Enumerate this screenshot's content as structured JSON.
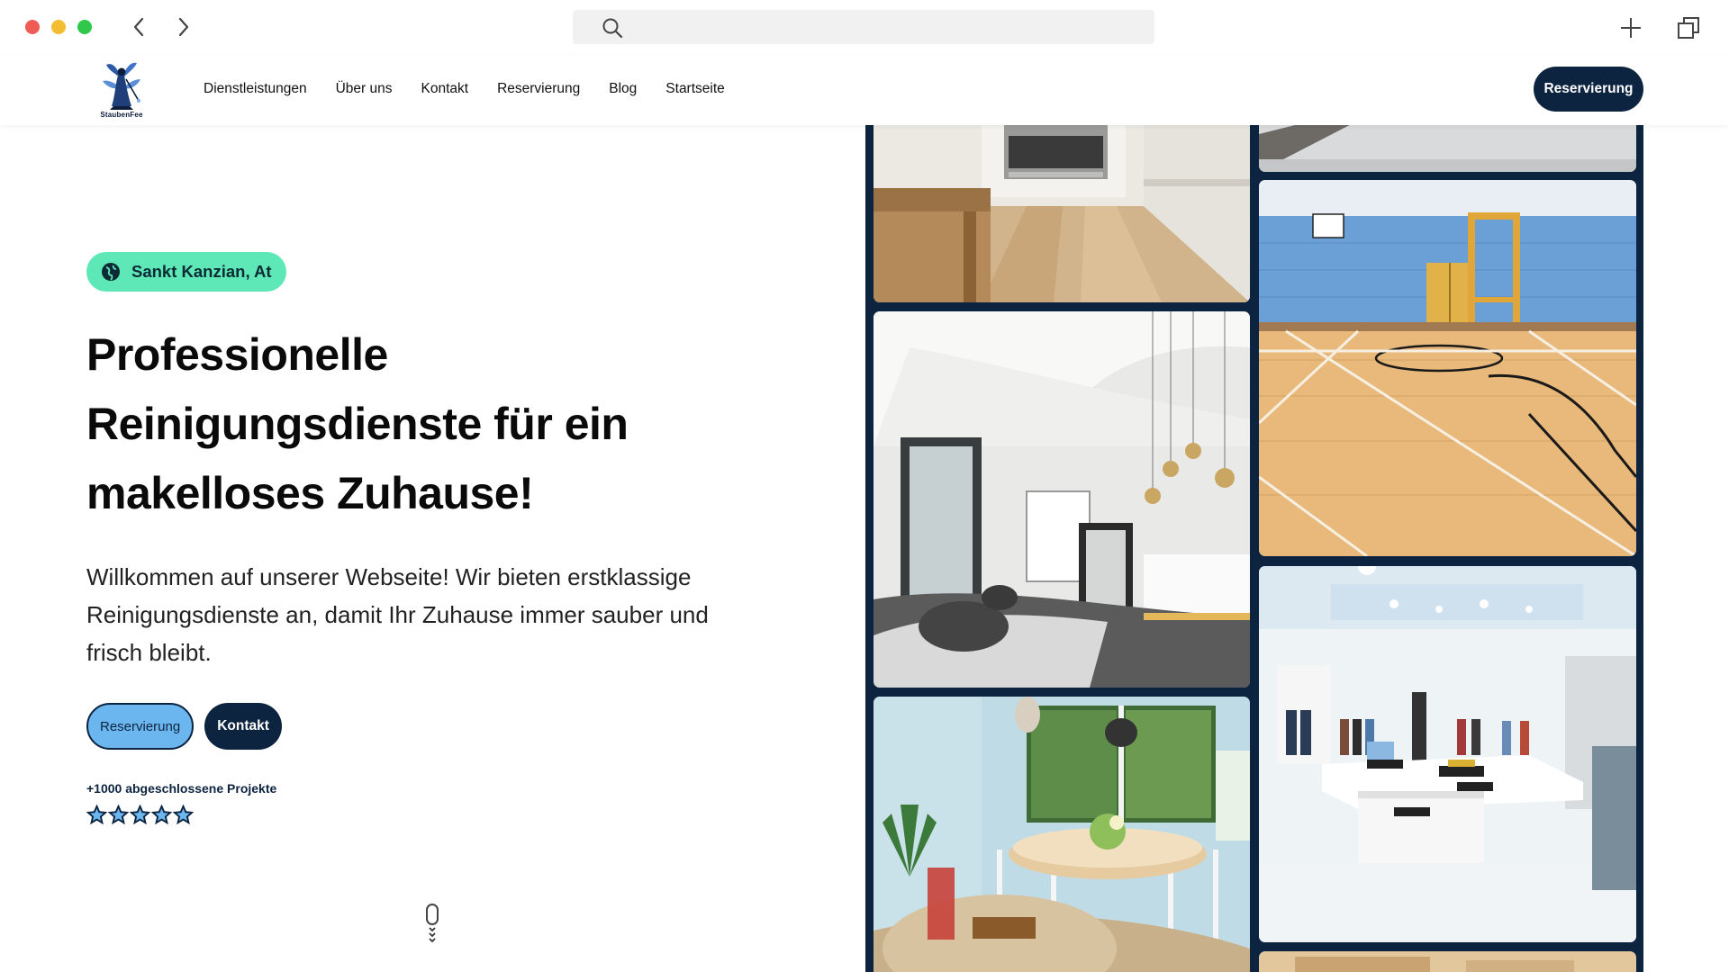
{
  "browser": {
    "back_icon": "chevron-left-icon",
    "forward_icon": "chevron-right-icon",
    "search_icon": "search-icon",
    "address_value": "",
    "new_tab_icon": "plus-icon",
    "tabs_icon": "copy-windows-icon"
  },
  "header": {
    "logo_text": "StaubenFee",
    "menu": [
      {
        "label": "Dienstleistungen"
      },
      {
        "label": "Über uns"
      },
      {
        "label": "Kontakt"
      },
      {
        "label": "Reservierung"
      },
      {
        "label": "Blog"
      },
      {
        "label": "Startseite"
      }
    ],
    "cta_label": "Reservierung"
  },
  "hero": {
    "location_badge": "Sankt Kanzian, At",
    "location_icon": "globe-icon",
    "title_lines": [
      "Professionelle",
      "Reinigungsdienste für ein",
      "makelloses Zuhause!"
    ],
    "text": "Willkommen auf unserer Webseite! Wir bieten erstklassige Reinigungsdienste an, damit Ihr Zuhause immer sauber und frisch bleibt.",
    "primary_button": "Reservierung",
    "secondary_button": "Kontakt",
    "projects_label": "+1000 abgeschlossene Projekte",
    "rating_stars": 5
  },
  "gallery": {
    "images": [
      {
        "name": "kitchen-photo"
      },
      {
        "name": "gym-floor-photo"
      },
      {
        "name": "lobby-photo"
      },
      {
        "name": "clothing-store-photo"
      },
      {
        "name": "dining-room-photo"
      }
    ]
  },
  "colors": {
    "navy": "#0d2440",
    "badge_mint": "#5ee8b8",
    "button_blue": "#6bb6ee"
  }
}
